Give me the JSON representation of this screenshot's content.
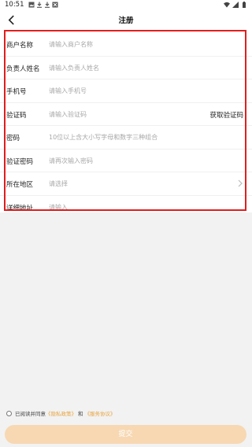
{
  "status_bar": {
    "time": "10:51"
  },
  "header": {
    "title": "注册"
  },
  "form": {
    "fields": [
      {
        "label": "商户名称",
        "placeholder": "请输入商户名称"
      },
      {
        "label": "负责人姓名",
        "placeholder": "请输入负责人姓名"
      },
      {
        "label": "手机号",
        "placeholder": "请输入手机号"
      },
      {
        "label": "验证码",
        "placeholder": "请输入验证码",
        "action": "获取验证码"
      },
      {
        "label": "密码",
        "placeholder": "10位以上含大小写字母和数字三种组合"
      },
      {
        "label": "验证密码",
        "placeholder": "请再次输入密码"
      },
      {
        "label": "所在地区",
        "placeholder": "请选择"
      },
      {
        "label": "详细地址",
        "placeholder": "请输入"
      }
    ]
  },
  "agreement": {
    "prefix": "已阅读并同意",
    "privacy_link": "《隐私政策》",
    "and": "和",
    "service_link": "《服务协议》"
  },
  "submit": {
    "label": "提交"
  },
  "colors": {
    "accent": "#e8a33d",
    "button_bg": "#f7d8b3",
    "highlight_outline": "#e01e1e"
  }
}
